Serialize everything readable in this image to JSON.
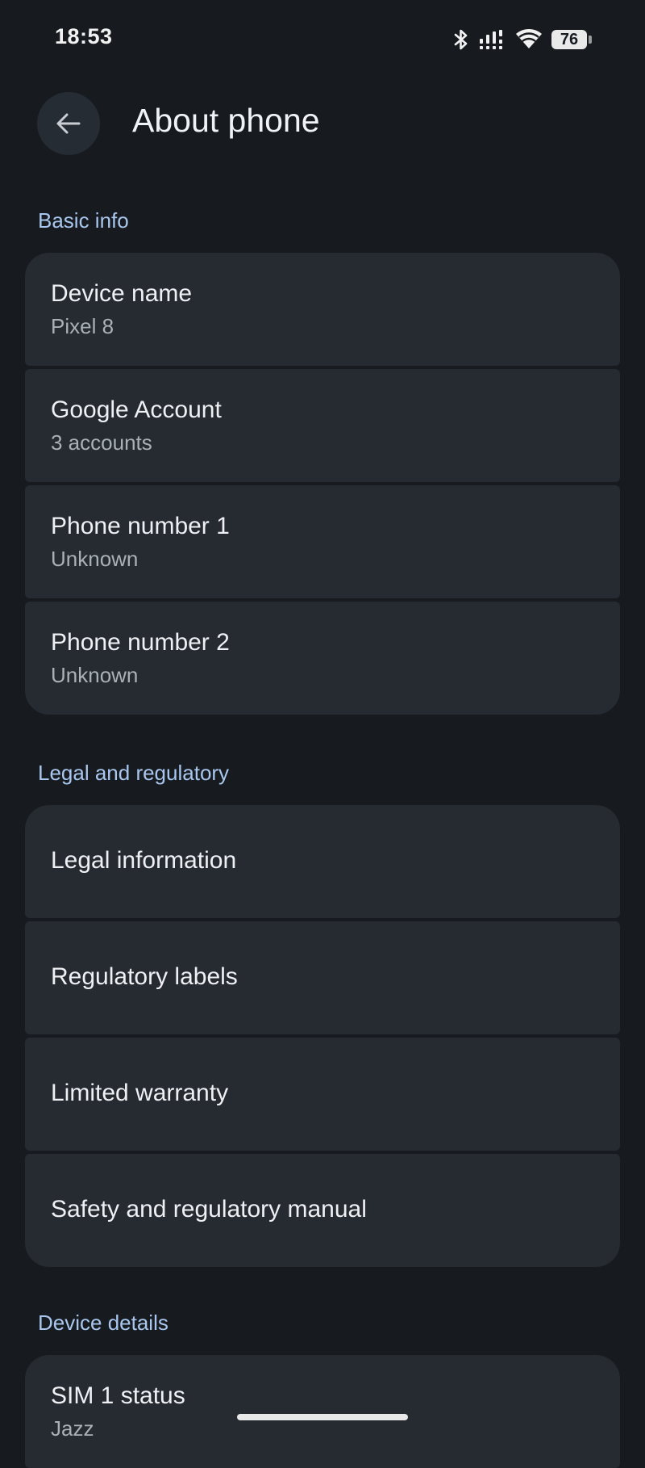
{
  "status_bar": {
    "time": "18:53",
    "battery": "76",
    "icons": [
      "bluetooth-icon",
      "signal-icon",
      "wifi-icon",
      "battery-icon"
    ]
  },
  "header": {
    "title": "About phone",
    "back_icon": "arrow-back-icon"
  },
  "sections": {
    "basic": {
      "title": "Basic info",
      "items": [
        {
          "title": "Device name",
          "summary": "Pixel 8"
        },
        {
          "title": "Google Account",
          "summary": "3 accounts"
        },
        {
          "title": "Phone number 1",
          "summary": "Unknown"
        },
        {
          "title": "Phone number 2",
          "summary": "Unknown"
        }
      ]
    },
    "legal": {
      "title": "Legal and regulatory",
      "items": [
        {
          "title": "Legal information"
        },
        {
          "title": "Regulatory labels"
        },
        {
          "title": "Limited warranty"
        },
        {
          "title": "Safety and regulatory manual"
        }
      ]
    },
    "device": {
      "title": "Device details",
      "items": [
        {
          "title": "SIM 1 status",
          "summary": "Jazz"
        }
      ]
    }
  },
  "colors": {
    "background": "#171b20",
    "card": "#262b32",
    "accent": "#a9c7ee"
  }
}
